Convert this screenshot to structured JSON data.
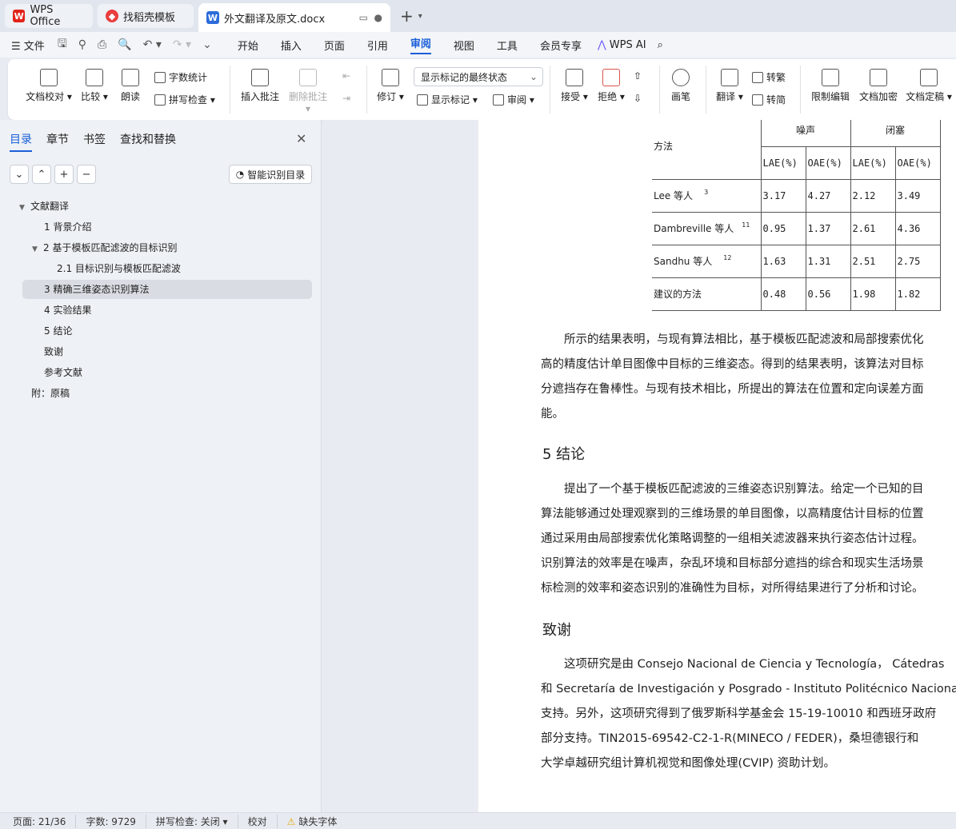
{
  "tabs": [
    {
      "label": "WPS Office"
    },
    {
      "label": "找稻壳模板"
    },
    {
      "label": "外文翻译及原文.docx"
    }
  ],
  "menu": {
    "file": "文件",
    "items": [
      "开始",
      "插入",
      "页面",
      "引用",
      "审阅",
      "视图",
      "工具",
      "会员专享"
    ],
    "active": "审阅",
    "wpsai": "WPS AI"
  },
  "ribbon": {
    "doc_check": "文档校对",
    "compare": "比较",
    "read_aloud": "朗读",
    "word_count": "字数统计",
    "spell_check": "拼写检查",
    "insert_comment": "插入批注",
    "delete_comment": "删除批注",
    "revise": "修订",
    "markup_state": "显示标记的最终状态",
    "show_markup": "显示标记",
    "review": "审阅",
    "accept": "接受",
    "reject": "拒绝",
    "pen": "画笔",
    "translate": "翻译",
    "to_traditional": "转繁",
    "to_simplified": "转简",
    "restrict_edit": "限制编辑",
    "encrypt": "文档加密",
    "finalize": "文档定稿"
  },
  "panel": {
    "tabs": [
      "目录",
      "章节",
      "书签",
      "查找和替换"
    ],
    "smart_toc": "智能识别目录",
    "toc": [
      {
        "label": "文献翻译",
        "level": 0,
        "expanded": true
      },
      {
        "label": "1 背景介绍",
        "level": 1
      },
      {
        "label": "2 基于模板匹配滤波的目标识别",
        "level": 1,
        "expanded": true
      },
      {
        "label": "2.1 目标识别与模板匹配滤波",
        "level": 2
      },
      {
        "label": "3 精确三维姿态识别算法",
        "level": 1,
        "selected": true
      },
      {
        "label": "4 实验结果",
        "level": 1
      },
      {
        "label": "5 结论",
        "level": 1
      },
      {
        "label": "致谢",
        "level": 1
      },
      {
        "label": "参考文献",
        "level": 1
      },
      {
        "label": "附：原稿",
        "level": 0
      }
    ]
  },
  "table": {
    "method_header": "方法",
    "group_noise": "噪声",
    "group_occlusion": "闭塞",
    "cols": [
      "LAE(%)",
      "OAE(%)",
      "LAE(%)",
      "OAE(%)"
    ],
    "rows": [
      {
        "method": "Lee 等人",
        "ref": "3",
        "values": [
          "3.17",
          "4.27",
          "2.12",
          "3.49"
        ]
      },
      {
        "method": "Dambreville 等人",
        "ref": "11",
        "values": [
          "0.95",
          "1.37",
          "2.61",
          "4.36"
        ]
      },
      {
        "method": "Sandhu 等人",
        "ref": "12",
        "values": [
          "1.63",
          "1.31",
          "2.51",
          "2.75"
        ]
      },
      {
        "method": "建议的方法",
        "ref": "",
        "values": [
          "0.48",
          "0.56",
          "1.98",
          "1.82"
        ]
      }
    ]
  },
  "doc": {
    "para1": [
      "　　所示的结果表明，与现有算法相比，基于模板匹配滤波和局部搜索优化",
      "高的精度估计单目图像中目标的三维姿态。得到的结果表明，该算法对目标",
      "分遮挡存在鲁棒性。与现有技术相比，所提出的算法在位置和定向误差方面",
      "能。"
    ],
    "heading_conclusion": "5  结论",
    "para2": [
      "　　提出了一个基于模板匹配滤波的三维姿态识别算法。给定一个已知的目",
      "算法能够通过处理观察到的三维场景的单目图像，以高精度估计目标的位置",
      "通过采用由局部搜索优化策略调整的一组相关滤波器来执行姿态估计过程。",
      "识别算法的效率是在噪声，杂乱环境和目标部分遮挡的综合和现实生活场景",
      "标检测的效率和姿态识别的准确性为目标，对所得结果进行了分析和讨论。"
    ],
    "heading_ack": "致谢",
    "para3": [
      "　　这项研究是由 Consejo Nacional de Ciencia y Tecnología，  Cátedras",
      "和 Secretaría de Investigación y Posgrado - Instituto Politécnico Naciona",
      "支持。另外，这项研究得到了俄罗斯科学基金会 15-19-10010 和西班牙政府",
      "部分支持。TIN2015-69542-C2-1-R(MINECO / FEDER)，桑坦德银行和",
      "大学卓越研究组计算机视觉和图像处理(CVIP) 资助计划。"
    ]
  },
  "status": {
    "page": "页面: 21/36",
    "words": "字数: 9729",
    "spell": "拼写检查: 关闭",
    "proof": "校对",
    "missing_font": "缺失字体"
  }
}
